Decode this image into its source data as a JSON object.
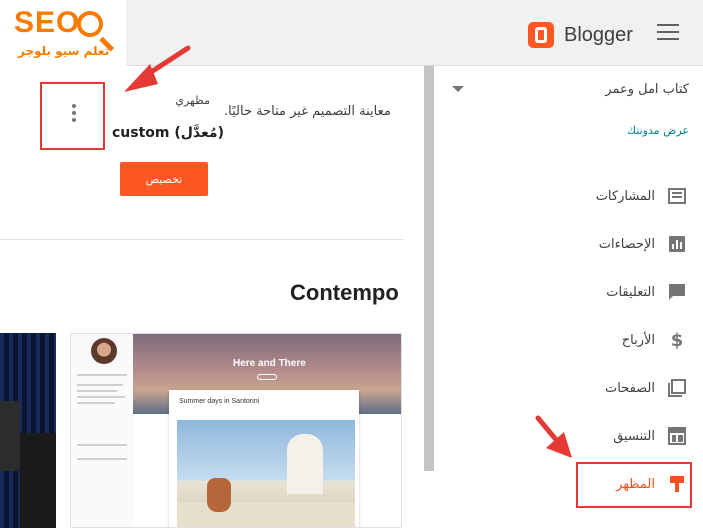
{
  "watermark": {
    "brand": "SEO",
    "subtitle": "تعلم سيو بلوجر"
  },
  "header": {
    "app_name": "Blogger",
    "menu_icon": "hamburger-icon"
  },
  "sidebar": {
    "blog_name": "كتاب امل وعمر",
    "view_blog": "عرض مدونتك",
    "items": [
      {
        "label": "المشاركات",
        "icon": "posts-icon"
      },
      {
        "label": "الإحصاءات",
        "icon": "stats-icon"
      },
      {
        "label": "التعليقات",
        "icon": "comments-icon"
      },
      {
        "label": "الأرباح",
        "icon": "dollar-icon"
      },
      {
        "label": "الصفحات",
        "icon": "pages-icon"
      },
      {
        "label": "التنسيق",
        "icon": "layout-icon"
      },
      {
        "label": "المظهر",
        "icon": "theme-brush-icon",
        "active": true
      }
    ]
  },
  "theme": {
    "preview_message": "معاينة التصميم غير متاحة حاليًا.",
    "label": "مظهري",
    "name": "custom (مُعدَّل)",
    "customize_button": "تخصيص"
  },
  "gallery": {
    "section_title": "Contempo",
    "preview": {
      "hero_title": "Here and There",
      "post_title": "Summer days in Santorini"
    }
  },
  "colors": {
    "accent": "#ff5722",
    "annotation": "#e53935",
    "link": "#00838f"
  }
}
